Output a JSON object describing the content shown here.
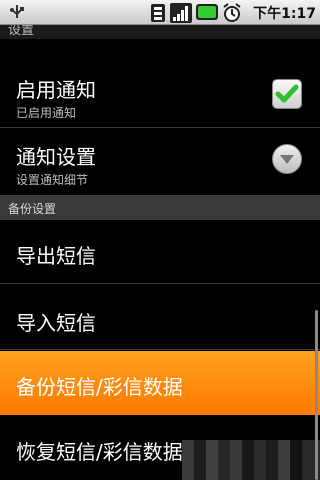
{
  "status_bar": {
    "time_prefix": "下午",
    "time": "1:17",
    "icons": [
      "signal-icon",
      "battery-icon",
      "alarm-icon"
    ]
  },
  "header": {
    "title": "设置"
  },
  "preferences": [
    {
      "title": "启用通知",
      "summary": "已启用通知",
      "widget": "checkbox",
      "checked": true
    },
    {
      "title": "通知设置",
      "summary": "设置通知细节",
      "widget": "dropdown"
    }
  ],
  "backup_section": {
    "label": "备份设置",
    "items": [
      {
        "title": "导出短信"
      },
      {
        "title": "导入短信"
      },
      {
        "title": "备份短信/彩信数据",
        "selected": true
      },
      {
        "title": "恢复短信/彩信数据"
      }
    ]
  },
  "colors": {
    "highlight": "#ff8a00",
    "check": "#2fbf2f",
    "background": "#000000"
  }
}
